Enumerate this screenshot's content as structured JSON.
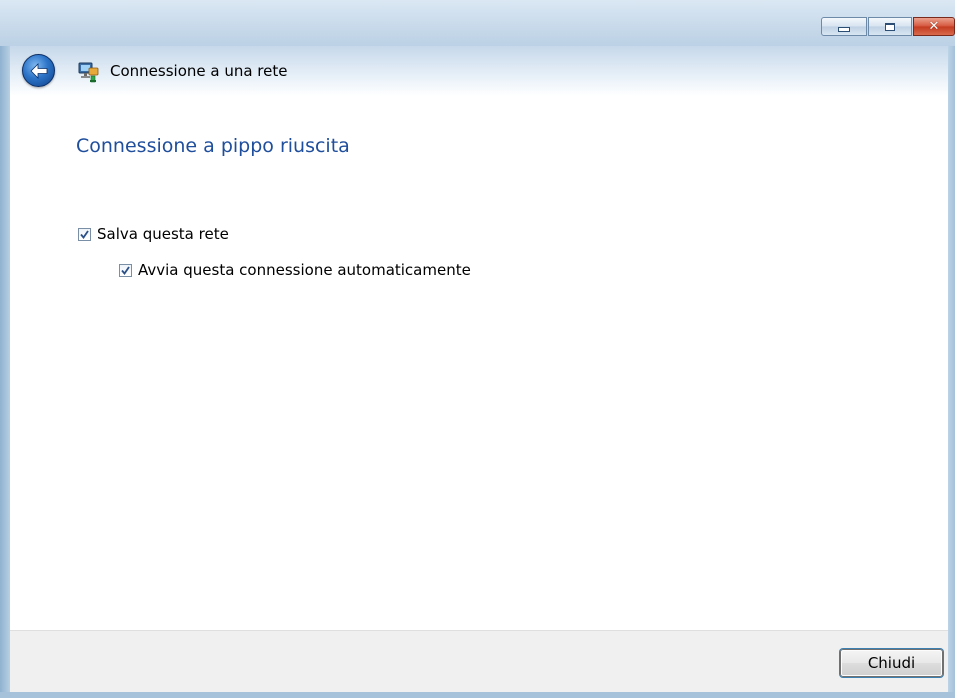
{
  "window": {
    "title": "Connessione a una rete",
    "controls": {
      "minimize_icon": "minimize-icon",
      "maximize_icon": "maximize-icon",
      "close_icon": "close-icon"
    }
  },
  "nav": {
    "back_icon": "back-arrow-icon",
    "app_icon": "network-icon"
  },
  "content": {
    "heading": "Connessione a pippo riuscita",
    "options": [
      {
        "label": "Salva questa rete",
        "checked": true
      },
      {
        "label": "Avvia questa connessione automaticamente",
        "checked": true
      }
    ]
  },
  "footer": {
    "close_button": "Chiudi"
  },
  "colors": {
    "heading": "#1f4e9c",
    "titlebar": "#c7d9ea",
    "close_button_red": "#c33a20"
  }
}
